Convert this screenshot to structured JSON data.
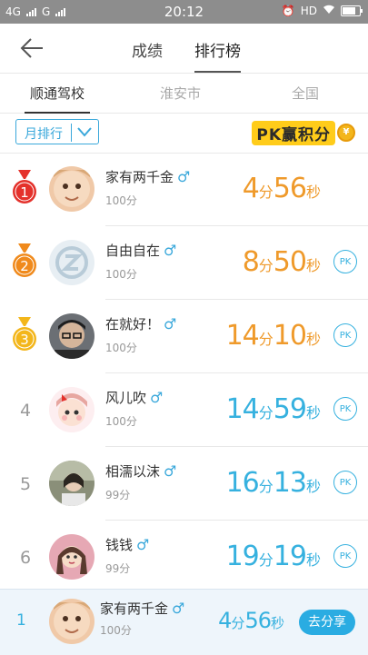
{
  "statusbar": {
    "network1": "4G",
    "network2": "G",
    "time": "20:12",
    "hd": "HD"
  },
  "nav": {
    "tabs": [
      "成绩",
      "排行榜"
    ]
  },
  "subtabs": [
    "顺通驾校",
    "淮安市",
    "全国"
  ],
  "filter": {
    "label": "月排行"
  },
  "pk_banner": {
    "text": "PK赢积分",
    "coin": "¥"
  },
  "rows": [
    {
      "rank": "1",
      "name": "家有两千金",
      "score": "100分",
      "min": "4",
      "sec": "56",
      "min_unit": "分",
      "sec_unit": "秒",
      "time_color": "orange",
      "pk": ""
    },
    {
      "rank": "2",
      "name": "自由自在",
      "score": "100分",
      "min": "8",
      "sec": "50",
      "min_unit": "分",
      "sec_unit": "秒",
      "time_color": "orange",
      "pk": "PK"
    },
    {
      "rank": "3",
      "name": "在就好！",
      "score": "100分",
      "min": "14",
      "sec": "10",
      "min_unit": "分",
      "sec_unit": "秒",
      "time_color": "orange",
      "pk": "PK"
    },
    {
      "rank": "4",
      "name": "风儿吹",
      "score": "100分",
      "min": "14",
      "sec": "59",
      "min_unit": "分",
      "sec_unit": "秒",
      "time_color": "blue",
      "pk": "PK"
    },
    {
      "rank": "5",
      "name": "相濡以沫",
      "score": "99分",
      "min": "16",
      "sec": "13",
      "min_unit": "分",
      "sec_unit": "秒",
      "time_color": "blue",
      "pk": "PK"
    },
    {
      "rank": "6",
      "name": "钱钱",
      "score": "99分",
      "min": "19",
      "sec": "19",
      "min_unit": "分",
      "sec_unit": "秒",
      "time_color": "blue",
      "pk": "PK"
    }
  ],
  "me": {
    "rank": "1",
    "name": "家有两千金",
    "score": "100分",
    "min": "4",
    "sec": "56",
    "min_unit": "分",
    "sec_unit": "秒",
    "share": "去分享"
  },
  "colors": {
    "accent": "#36b1df",
    "orange": "#ef9a2b",
    "medal_gold": "#f3b61b",
    "medal_red": "#e4312b",
    "medal_orange": "#f08a1c"
  }
}
